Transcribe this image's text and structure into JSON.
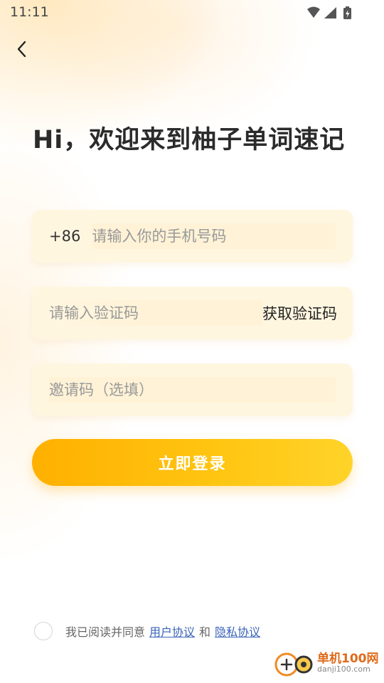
{
  "status_bar": {
    "time": "11:11"
  },
  "header": {
    "back_icon": "chevron-left-icon"
  },
  "title": "Hi，欢迎来到柚子单词速记",
  "phone_field": {
    "prefix": "+86",
    "placeholder": "请输入你的手机号码",
    "value": ""
  },
  "code_field": {
    "placeholder": "请输入验证码",
    "value": "",
    "get_code_label": "获取验证码"
  },
  "invite_field": {
    "placeholder": "邀请码（选填）",
    "value": ""
  },
  "login_button": {
    "label": "立即登录"
  },
  "agreement": {
    "prefix": "我已阅读并同意",
    "user_agreement": "用户协议",
    "conjunction": "和",
    "privacy_agreement": "隐私协议",
    "checked": false
  },
  "watermark": {
    "title": "单机100网",
    "subtitle": "danji100.com"
  },
  "colors": {
    "accent_start": "#ffb000",
    "accent_end": "#ffd32a",
    "link": "#3a63b8",
    "field_bg": "#fff6e0"
  }
}
